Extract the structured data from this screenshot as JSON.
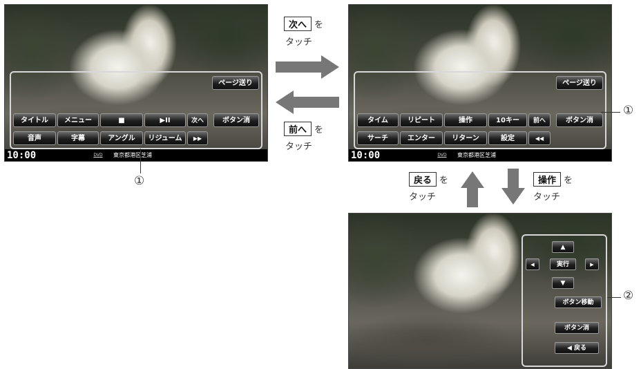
{
  "screens": {
    "status": {
      "time": "10:00",
      "media": "DVD",
      "location": "東京都港区芝浦"
    },
    "page1": {
      "page_button": "ページ送り",
      "row1": [
        "タイトル",
        "メニュー",
        "■",
        "▶II"
      ],
      "next": "次へ",
      "hide": "ボタン消",
      "row2": [
        "音声",
        "字幕",
        "アングル",
        "リジューム"
      ],
      "ff": "▶▶"
    },
    "page2": {
      "page_button": "ページ送り",
      "row1": [
        "タイム",
        "リピート",
        "操作",
        "10キー"
      ],
      "prev": "前へ",
      "hide": "ボタン消",
      "row2": [
        "サーチ",
        "エンター",
        "リターン",
        "設定"
      ],
      "rew": "◀◀"
    },
    "page3": {
      "up": "▲",
      "left": "◀",
      "exec": "実行",
      "right": "▶",
      "down": "▼",
      "move": "ボタン移動",
      "hide": "ボタン消",
      "back": "◀  戻る"
    }
  },
  "instructions": {
    "next": {
      "key": "次へ",
      "suffix": "を",
      "action": "タッチ"
    },
    "prev": {
      "key": "前へ",
      "suffix": "を",
      "action": "タッチ"
    },
    "back": {
      "key": "戻る",
      "suffix": "を",
      "action": "タッチ"
    },
    "ops": {
      "key": "操作",
      "suffix": "を",
      "action": "タッチ"
    }
  },
  "callouts": {
    "one": "①",
    "two": "②"
  },
  "colors": {
    "arrow": "#777777",
    "frame": "#d8d8d8"
  }
}
